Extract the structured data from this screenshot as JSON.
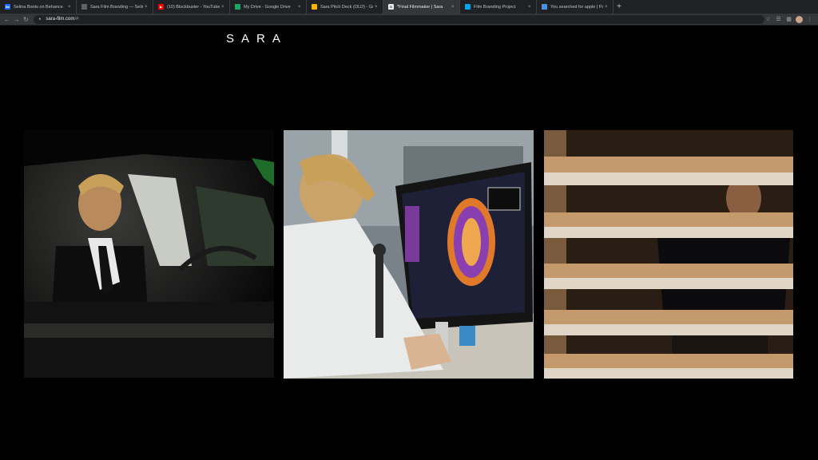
{
  "browser": {
    "tabs": [
      {
        "label": "Selina Boots on Behance",
        "favicon": "behance-icon",
        "favicon_color": "#1769ff",
        "favicon_text": "Bē",
        "active": false
      },
      {
        "label": "Sara Film Branding — Selina I",
        "favicon": "globe-icon",
        "favicon_color": "#5f6368",
        "favicon_text": "",
        "active": false
      },
      {
        "label": "(10) Blockbuster - YouTube",
        "favicon": "youtube-icon",
        "favicon_color": "#ff0000",
        "favicon_text": "▶",
        "active": false
      },
      {
        "label": "My Drive - Google Drive",
        "favicon": "drive-icon",
        "favicon_color": "#1fa463",
        "favicon_text": "",
        "active": false
      },
      {
        "label": "Sara Pitch Deck (OLD) - Goog",
        "favicon": "slides-icon",
        "favicon_color": "#f4b400",
        "favicon_text": "",
        "active": false
      },
      {
        "label": "*Final Filmmaker | Sara",
        "favicon": "squarespace-icon",
        "favicon_color": "#e8eaed",
        "favicon_text": "S",
        "active": true
      },
      {
        "label": "Film Branding Project",
        "favicon": "windows-icon",
        "favicon_color": "#00a4ef",
        "favicon_text": "",
        "active": false
      },
      {
        "label": "You searched for apple | Pag",
        "favicon": "site-icon",
        "favicon_color": "#4a90e2",
        "favicon_text": "",
        "active": false
      }
    ],
    "close_glyph": "×",
    "new_tab_glyph": "+",
    "url_host": "sara-film.com",
    "url_path": "/#"
  },
  "site": {
    "logo": "SARA"
  },
  "stills": [
    {
      "name": "car-driver-still",
      "subject": "man in suit in car at night"
    },
    {
      "name": "lab-computer-still",
      "subject": "man at computer with brain scan"
    },
    {
      "name": "shelves-still",
      "subject": "man behind wooden shelves"
    }
  ]
}
